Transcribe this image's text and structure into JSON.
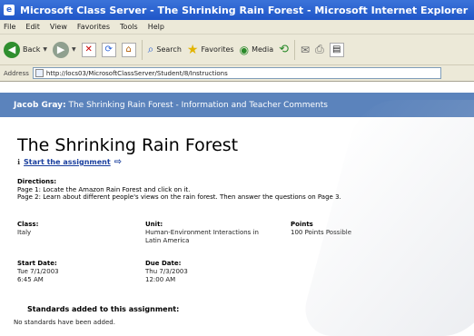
{
  "window": {
    "title": "Microsoft Class Server - The Shrinking Rain Forest - Microsoft Internet Explorer"
  },
  "menu": [
    "File",
    "Edit",
    "View",
    "Favorites",
    "Tools",
    "Help"
  ],
  "toolbar": {
    "back": "Back",
    "search": "Search",
    "favorites": "Favorites",
    "media": "Media"
  },
  "address": {
    "label": "Address",
    "url": "http://locs03/MicrosoftClassServer/Student/8/Instructions"
  },
  "banner": {
    "user": "Jacob Gray:",
    "text": "The Shrinking Rain Forest - Information and Teacher Comments"
  },
  "assignment": {
    "title": "The Shrinking Rain Forest",
    "start_link": "Start the assignment",
    "directions_label": "Directions:",
    "directions": [
      "Page 1: Locate the Amazon Rain Forest and click on it.",
      "Page 2: Learn about different people's views on the rain forest. Then answer the questions on Page 3."
    ],
    "class_label": "Class:",
    "class_value": "Italy",
    "unit_label": "Unit:",
    "unit_value_1": "Human-Environment Interactions in",
    "unit_value_2": "Latin America",
    "points_label": "Points",
    "points_value": "100 Points Possible",
    "start_label": "Start Date:",
    "start_date": "Tue 7/1/2003",
    "start_time": "6:45 AM",
    "due_label": "Due Date:",
    "due_date": "Thu 7/3/2003",
    "due_time": "12:00 AM",
    "standards_label": "Standards added to this assignment:",
    "standards_value": "No standards have been added."
  }
}
